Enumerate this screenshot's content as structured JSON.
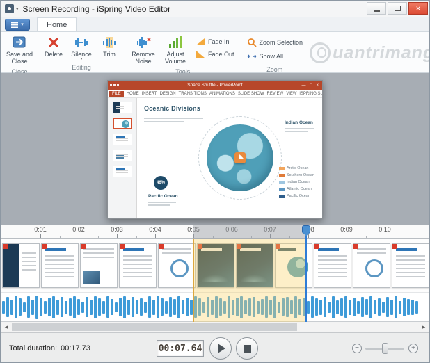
{
  "window": {
    "title": "Screen Recording - iSpring Video Editor"
  },
  "colors": {
    "app_menu": "#4a7cc0",
    "close_button": "#dc4a33",
    "ppt_titlebar": "#b7472a",
    "selection": "#f5d37a",
    "waveform": "#3f9bd8",
    "playhead": "#2f7cd6",
    "clip_marker": "#d93b2b"
  },
  "ribbon": {
    "tab": "Home",
    "groups": [
      {
        "label": "Close",
        "buttons": [
          {
            "label": "Save and Close"
          }
        ]
      },
      {
        "label": "Editing",
        "buttons": [
          {
            "label": "Delete"
          },
          {
            "label": "Silence",
            "has_dropdown": true
          },
          {
            "label": "Trim"
          }
        ]
      },
      {
        "label": "Tools",
        "buttons": [
          {
            "label": "Remove Noise"
          },
          {
            "label": "Adjust Volume"
          },
          {
            "label": "Fade In"
          },
          {
            "label": "Fade Out"
          }
        ]
      },
      {
        "label": "Zoom",
        "buttons": [
          {
            "label": "Zoom Selection"
          },
          {
            "label": "Show All"
          }
        ]
      }
    ],
    "watermark": "uantrimang"
  },
  "preview": {
    "powerpoint": {
      "titlebar": "Space Shuttle - PowerPoint",
      "tabs": [
        "FILE",
        "HOME",
        "INSERT",
        "DESIGN",
        "TRANSITIONS",
        "ANIMATIONS",
        "SLIDE SHOW",
        "REVIEW",
        "VIEW",
        "iSPRING SUITE 8"
      ],
      "thumbnails": [
        {
          "style": "th-title",
          "selected": false
        },
        {
          "style": "th-globe",
          "selected": true
        },
        {
          "style": "th-text",
          "selected": false
        },
        {
          "style": "th-photo",
          "selected": false
        },
        {
          "style": "th-text",
          "selected": false
        }
      ],
      "slide": {
        "title": "Oceanic Divisions",
        "badge": "46%",
        "pacific_label": "Pacific Ocean",
        "indian_label": "Indian Ocean",
        "legend": [
          {
            "label": "Arctic Ocean",
            "color": "#f2a65e"
          },
          {
            "label": "Southern Ocean",
            "color": "#e07b39"
          },
          {
            "label": "Indian Ocean",
            "color": "#9fc6e0"
          },
          {
            "label": "Atlantic Ocean",
            "color": "#5b96c2"
          },
          {
            "label": "Pacific Ocean",
            "color": "#2f5e8c"
          }
        ]
      }
    }
  },
  "timeline": {
    "ticks": [
      "0:01",
      "0:02",
      "0:03",
      "0:04",
      "0:05",
      "0:06",
      "0:07",
      "0:08",
      "0:09",
      "0:10"
    ],
    "clips": [
      {
        "style": "c-title",
        "marker": true
      },
      {
        "style": "c-text",
        "marker": true
      },
      {
        "style": "c-photo",
        "marker": true
      },
      {
        "style": "c-text",
        "marker": true
      },
      {
        "style": "c-diagram",
        "marker": true
      },
      {
        "style": "c-dark",
        "marker": true
      },
      {
        "style": "c-dark",
        "marker": true
      },
      {
        "style": "c-globe",
        "marker": true
      },
      {
        "style": "c-text",
        "marker": true
      },
      {
        "style": "c-diagram",
        "marker": true
      },
      {
        "style": "c-text",
        "marker": true
      }
    ],
    "waveform": [
      0.5,
      0.8,
      0.6,
      0.9,
      0.7,
      0.4,
      0.85,
      0.6,
      0.95,
      0.7,
      0.5,
      0.75,
      0.9,
      0.6,
      0.8,
      0.5,
      0.7,
      0.9,
      0.65,
      0.45,
      0.8,
      0.6,
      0.9,
      0.7,
      0.5,
      0.85,
      0.65,
      0.4,
      0.75,
      0.9,
      0.6,
      0.8,
      0.55,
      0.7,
      0.45,
      0.85,
      0.6,
      0.9,
      0.7,
      0.5,
      0.8,
      0.65,
      0.9,
      0.55,
      0.75,
      0.6,
      0.85,
      0.7,
      0.45,
      0.8,
      0.6,
      0.9,
      0.7,
      0.5,
      0.85,
      0.6,
      0.75,
      0.9,
      0.55,
      0.7,
      0.8,
      0.5,
      0.65,
      0.85,
      0.6,
      0.9,
      0.45,
      0.7,
      0.8,
      0.55,
      0.9,
      0.65,
      0.75,
      0.5,
      0.85,
      0.7,
      0.6,
      0.8,
      0.45,
      0.9,
      0.55,
      0.7,
      0.85,
      0.6,
      0.75,
      0.5,
      0.8,
      0.65,
      0.9,
      0.55,
      0.7,
      0.45,
      0.8,
      0.6,
      0.85,
      0.5,
      0.75,
      0.65,
      0.6,
      0.5
    ]
  },
  "footer": {
    "total_duration_label": "Total duration:",
    "total_duration_value": "00:17.73",
    "current_time": "00:07.64"
  }
}
